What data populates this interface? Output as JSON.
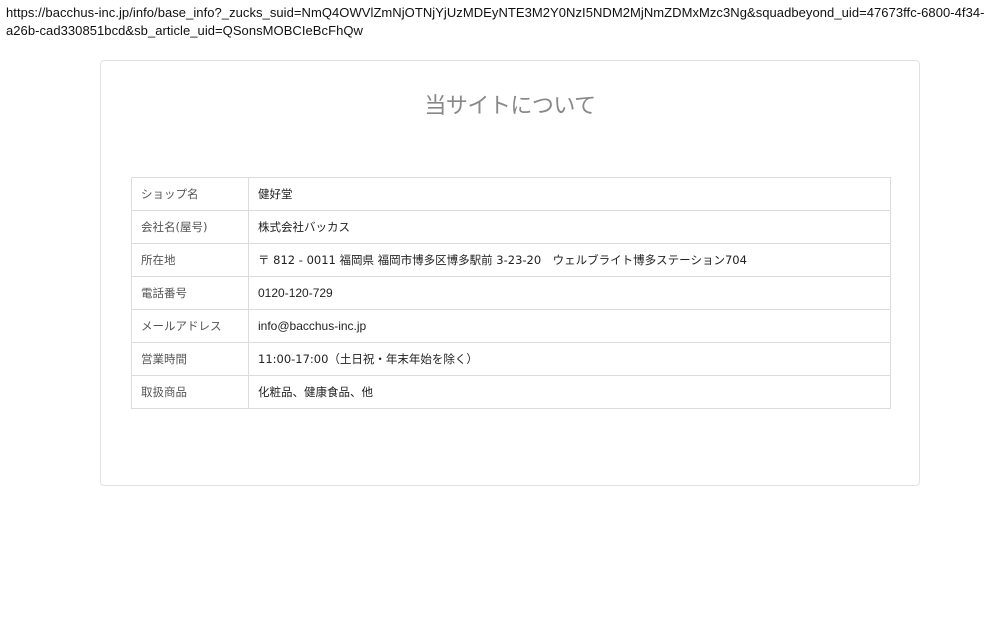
{
  "url_line": "https://bacchus-inc.jp/info/base_info?_zucks_suid=NmQ4OWVlZmNjOTNjYjUzMDEyNTE3M2Y0NzI5NDM2MjNmZDMxMzc3Ng&squadbeyond_uid=47673ffc-6800-4f34-a26b-cad330851bcd&sb_article_uid=QSonsMOBCIeBcFhQw",
  "page": {
    "title": "当サイトについて"
  },
  "info_table": {
    "rows": [
      {
        "label": "ショップ名",
        "value": "健好堂"
      },
      {
        "label": "会社名(屋号)",
        "value": "株式会社バッカス"
      },
      {
        "label": "所在地",
        "value": "〒 812 - 0011 福岡県 福岡市博多区博多駅前 3-23-20　ウェルブライト博多ステーション704"
      },
      {
        "label": "電話番号",
        "value": "0120-120-729"
      },
      {
        "label": "メールアドレス",
        "value": "info@bacchus-inc.jp"
      },
      {
        "label": "営業時間",
        "value": "11:00-17:00（土日祝・年末年始を除く）"
      },
      {
        "label": "取扱商品",
        "value": "化粧品、健康食品、他"
      }
    ]
  }
}
